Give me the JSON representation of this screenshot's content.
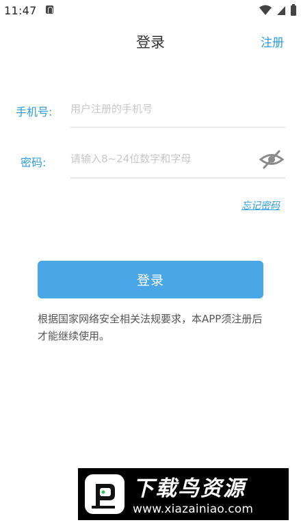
{
  "status_bar": {
    "time": "11:47",
    "notification_icon": "a-badge-icon",
    "icons": [
      "wifi-icon",
      "signal-icon",
      "battery-icon"
    ]
  },
  "nav": {
    "title": "登录",
    "register_label": "注册"
  },
  "form": {
    "phone": {
      "label": "手机号:",
      "placeholder": "用户注册的手机号",
      "value": ""
    },
    "password": {
      "label": "密码:",
      "placeholder": "请输入8~24位数字和字母",
      "value": "",
      "toggle_icon": "eye-hidden-icon"
    },
    "forgot_label": "忘记密码"
  },
  "login_button_label": "登录",
  "notice": "根据国家网络安全相关法规要求，本APP须注册后才能继续使用。",
  "watermark": {
    "title": "下载鸟资源",
    "url": "www.xiazainiao.com"
  },
  "colors": {
    "accent": "#2a9be0",
    "button": "#4aa6e6",
    "divider": "#e9e9e9",
    "placeholder": "#c7c7c7"
  }
}
